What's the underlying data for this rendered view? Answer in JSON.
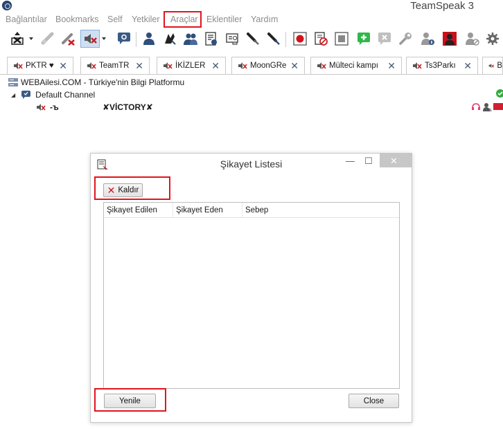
{
  "app": {
    "title": "TeamSpeak 3"
  },
  "menu": [
    "Bağlantılar",
    "Bookmarks",
    "Self",
    "Yetkiler",
    "Araçlar",
    "Eklentiler",
    "Yardım"
  ],
  "tabs": [
    {
      "label": "PKTR ♥"
    },
    {
      "label": "TeamTR"
    },
    {
      "label": "İKİZLER"
    },
    {
      "label": "MoonGRe"
    },
    {
      "label": "Mülteci kampı"
    },
    {
      "label": "Ts3Parkı"
    },
    {
      "label": "B"
    }
  ],
  "tree": {
    "server": "WEBAilesi.COM - Türkiye'nin Bilgi Platformu",
    "channel": "Default Channel",
    "client_nick": "-ъ",
    "client_name": "✘VİCTORY✘"
  },
  "dialog": {
    "title": "Şikayet Listesi",
    "remove_label": "Kaldır",
    "columns": [
      "Şikayet Edilen",
      "Şikayet Eden",
      "Sebep"
    ],
    "refresh_label": "Yenile",
    "close_label": "Close"
  },
  "colors": {
    "highlight": "#e0141d",
    "accent_blue": "#2b4a78",
    "muted_menu": "#8c8c8c"
  },
  "icons": {
    "toolbar": [
      "connect-icon",
      "disconnect-icon",
      "away-icon",
      "mute-microphone-icon",
      "chat-icon",
      "contacts-icon",
      "ban-list-icon",
      "privilege-key-icon",
      "server-info-icon",
      "permissions-icon",
      "file-transfer-icon",
      "record-icon",
      "complaint-icon",
      "stop-icon",
      "add-icon",
      "remove-icon",
      "settings-tool-icon",
      "client-info-icon",
      "avatar-icon",
      "permission-off-icon",
      "gear-icon"
    ]
  }
}
